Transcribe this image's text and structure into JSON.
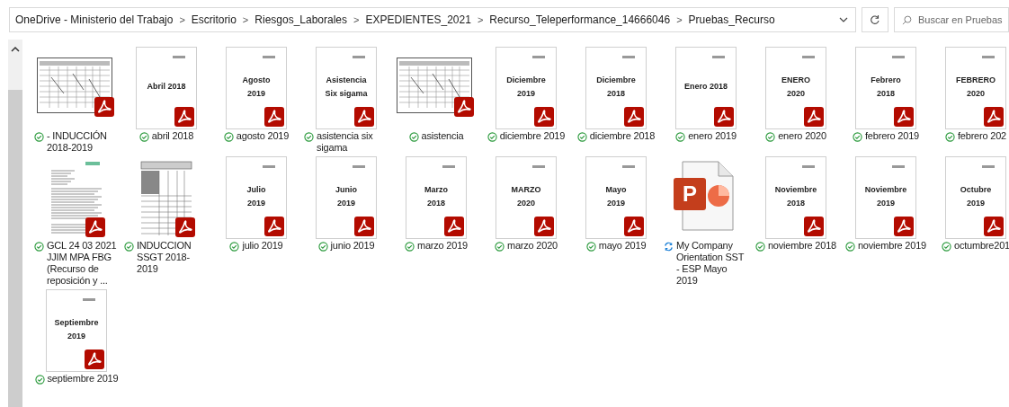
{
  "address_bar": {
    "breadcrumbs": [
      "OneDrive - Ministerio del Trabajo",
      "Escritorio",
      "Riesgos_Laborales",
      "EXPEDIENTES_2021",
      "Recurso_Teleperformance_14666046",
      "Pruebas_Recurso"
    ],
    "separator": ">"
  },
  "search": {
    "placeholder": "Buscar en Pruebas"
  },
  "files": [
    {
      "kind": "scan",
      "label": "- INDUCCIÓN 2018-2019",
      "syncing": false
    },
    {
      "kind": "cover",
      "title_lines": [
        "Abril 2018"
      ],
      "label": "abril 2018",
      "syncing": false
    },
    {
      "kind": "cover",
      "title_lines": [
        "Agosto",
        "2019"
      ],
      "label": "agosto 2019",
      "syncing": false
    },
    {
      "kind": "cover",
      "title_lines": [
        "Asistencia",
        "Six sigama"
      ],
      "label": "asistencia six sigama",
      "syncing": false
    },
    {
      "kind": "scan",
      "label": "asistencia",
      "syncing": false
    },
    {
      "kind": "cover",
      "title_lines": [
        "Diciembre",
        "2019"
      ],
      "label": "diciembre 2019",
      "syncing": false
    },
    {
      "kind": "cover",
      "title_lines": [
        "Diciembre",
        "2018"
      ],
      "label": "diciembre 2018",
      "syncing": false
    },
    {
      "kind": "cover",
      "title_lines": [
        "Enero 2018"
      ],
      "label": "enero 2019",
      "syncing": false
    },
    {
      "kind": "cover",
      "title_lines": [
        "ENERO",
        "2020"
      ],
      "label": "enero 2020",
      "syncing": false
    },
    {
      "kind": "cover",
      "title_lines": [
        "Febrero",
        "2018"
      ],
      "label": "febrero 2019",
      "syncing": false
    },
    {
      "kind": "cover",
      "title_lines": [
        "FEBRERO",
        "2020"
      ],
      "label": "febrero 202",
      "syncing": false
    },
    {
      "kind": "letter",
      "label": "GCL 24 03 2021 JJIM MPA FBG (Recurso de reposición y ...",
      "syncing": false
    },
    {
      "kind": "form",
      "label": "INDUCCION SSGT 2018-2019",
      "syncing": false
    },
    {
      "kind": "cover",
      "title_lines": [
        "Julio",
        "2019"
      ],
      "label": "julio 2019",
      "syncing": false
    },
    {
      "kind": "cover",
      "title_lines": [
        "Junio",
        "2019"
      ],
      "label": "junio 2019",
      "syncing": false
    },
    {
      "kind": "cover",
      "title_lines": [
        "Marzo",
        "2018"
      ],
      "label": "marzo 2019",
      "syncing": false
    },
    {
      "kind": "cover",
      "title_lines": [
        "MARZO",
        "2020"
      ],
      "label": "marzo 2020",
      "syncing": false
    },
    {
      "kind": "cover",
      "title_lines": [
        "Mayo",
        "2019"
      ],
      "label": "mayo 2019",
      "syncing": false
    },
    {
      "kind": "presentation",
      "badge_letter": "P",
      "label": "My Company Orientation SST - ESP Mayo 2019",
      "syncing": true
    },
    {
      "kind": "cover",
      "title_lines": [
        "Noviembre",
        "2018"
      ],
      "label": "noviembre 2018",
      "syncing": false
    },
    {
      "kind": "cover",
      "title_lines": [
        "Noviembre",
        "2019"
      ],
      "label": "noviembre 2019",
      "syncing": false
    },
    {
      "kind": "cover",
      "title_lines": [
        "Octubre",
        "2019"
      ],
      "label": "octumbre201",
      "syncing": false
    },
    {
      "kind": "cover",
      "title_lines": [
        "Septiembre",
        "2019"
      ],
      "label": "septiembre 2019",
      "syncing": false
    }
  ]
}
